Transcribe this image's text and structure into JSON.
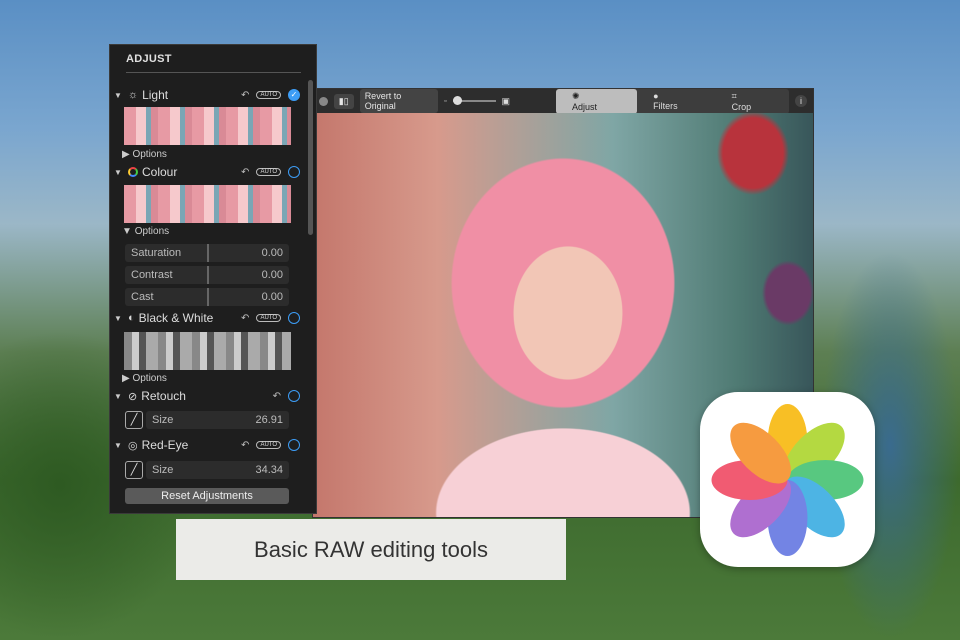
{
  "panel": {
    "title": "ADJUST",
    "light": {
      "label": "Light",
      "auto": "AUTO",
      "options": "Options"
    },
    "colour": {
      "label": "Colour",
      "auto": "AUTO",
      "options": "Options",
      "sliders": [
        {
          "label": "Saturation",
          "value": "0.00"
        },
        {
          "label": "Contrast",
          "value": "0.00"
        },
        {
          "label": "Cast",
          "value": "0.00"
        }
      ]
    },
    "bw": {
      "label": "Black & White",
      "auto": "AUTO",
      "options": "Options"
    },
    "retouch": {
      "label": "Retouch",
      "size_label": "Size",
      "size": "26.91"
    },
    "redeye": {
      "label": "Red-Eye",
      "auto": "AUTO",
      "size_label": "Size",
      "size": "34.34"
    },
    "reset": "Reset Adjustments"
  },
  "toolbar": {
    "revert": "Revert to Original",
    "adjust": "Adjust",
    "filters": "Filters",
    "crop": "Crop",
    "info": "i"
  },
  "caption": "Basic RAW editing tools",
  "colors": {
    "accent": "#3d9df6"
  }
}
